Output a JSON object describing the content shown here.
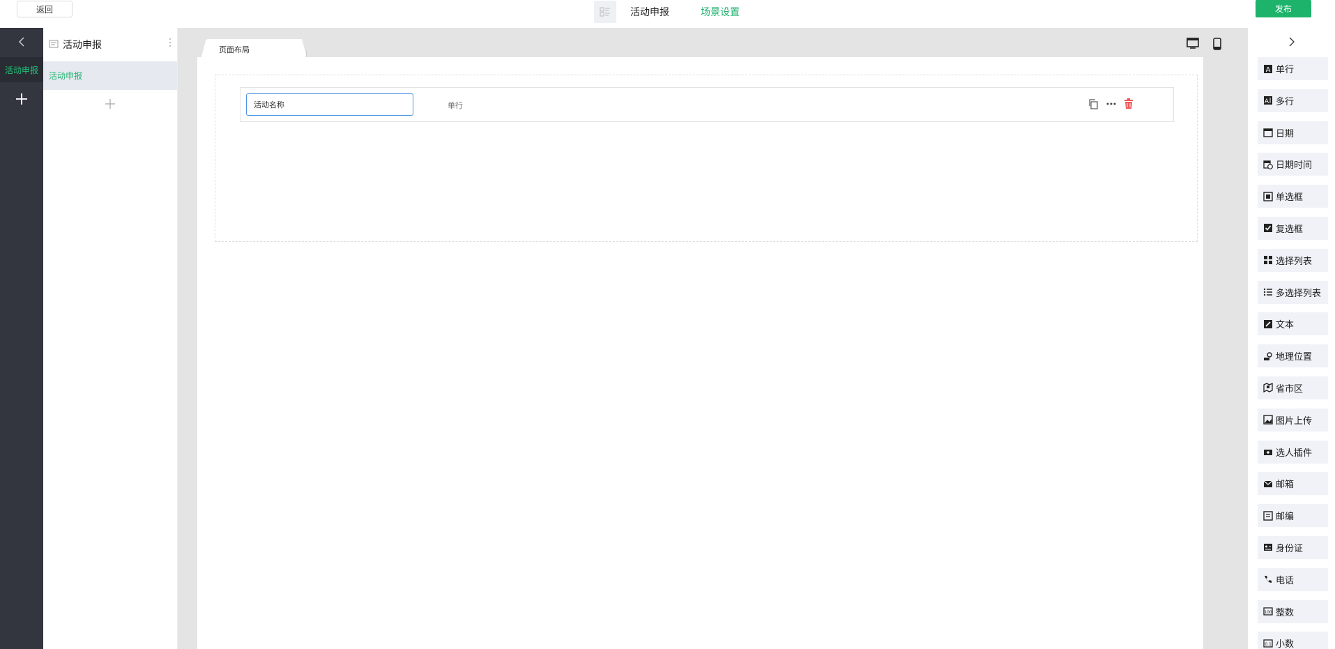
{
  "topbar": {
    "back_label": "返回",
    "layout_icon": "layout-list-icon",
    "title": "活动申报",
    "scene_settings": "场景设置",
    "publish_label": "发布",
    "accent_color": "#1db36b"
  },
  "rail": {
    "collapse_icon": "chevron-left-icon",
    "active_item": "活动申报",
    "add_icon": "plus-icon"
  },
  "pages": {
    "header_icon": "form-icon",
    "title": "活动申报",
    "menu_icon": "more-vertical-icon",
    "items": [
      {
        "label": "活动申报"
      }
    ],
    "add_icon": "plus-icon"
  },
  "canvas": {
    "tab_label": "页面布局",
    "device_icons": [
      "desktop-icon",
      "mobile-icon"
    ],
    "field": {
      "value": "活动名称",
      "type_label": "单行",
      "actions": [
        "copy-icon",
        "more-horizontal-icon",
        "trash-icon"
      ]
    }
  },
  "widgets": {
    "collapse_icon": "chevron-right-icon",
    "items": [
      {
        "label": "单行",
        "icon": "single-line-icon"
      },
      {
        "label": "多行",
        "icon": "multi-line-icon"
      },
      {
        "label": "日期",
        "icon": "calendar-icon"
      },
      {
        "label": "日期时间",
        "icon": "calendar-clock-icon"
      },
      {
        "label": "单选框",
        "icon": "radio-icon"
      },
      {
        "label": "复选框",
        "icon": "checkbox-icon"
      },
      {
        "label": "选择列表",
        "icon": "grid-icon"
      },
      {
        "label": "多选择列表",
        "icon": "list-icon"
      },
      {
        "label": "文本",
        "icon": "edit-icon"
      },
      {
        "label": "地理位置",
        "icon": "location-icon"
      },
      {
        "label": "省市区",
        "icon": "map-icon"
      },
      {
        "label": "图片上传",
        "icon": "image-icon"
      },
      {
        "label": "选人插件",
        "icon": "person-picker-icon"
      },
      {
        "label": "邮箱",
        "icon": "mail-icon"
      },
      {
        "label": "邮编",
        "icon": "postcode-icon"
      },
      {
        "label": "身份证",
        "icon": "id-card-icon"
      },
      {
        "label": "电话",
        "icon": "phone-icon"
      },
      {
        "label": "整数",
        "icon": "integer-icon"
      },
      {
        "label": "小数",
        "icon": "decimal-icon"
      }
    ]
  }
}
